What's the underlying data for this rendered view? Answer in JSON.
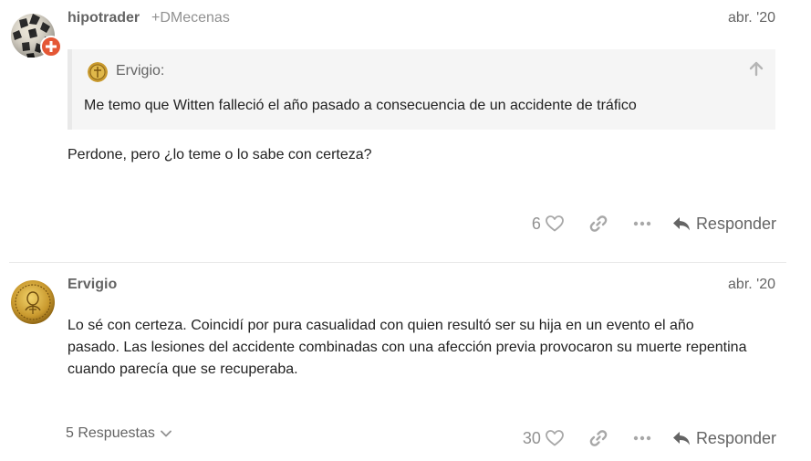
{
  "posts": [
    {
      "username": "hipotrader",
      "group": "+DMecenas",
      "date": "abr. '20",
      "quote": {
        "author": "Ervigio:",
        "text": "Me temo que Witten falleció el año pasado a consecuencia de un accidente de tráfico"
      },
      "body": "Perdone, pero ¿lo teme o lo sabe con certeza?",
      "likes": "6",
      "reply_label": "Responder"
    },
    {
      "username": "Ervigio",
      "date": "abr. '20",
      "body": "Lo sé con certeza. Coincidí por pura casualidad con quien resultó ser su hija en un evento el año pasado. Las lesiones del accidente combinadas con una afección previa provocaron su muerte repentina cuando parecía que se recuperaba.",
      "likes": "30",
      "replies_label": "5 Respuestas",
      "reply_label": "Responder"
    }
  ],
  "icons": {
    "flair": "plus-icon",
    "quote_nav": "arrow-up-icon",
    "like": "heart-icon",
    "share": "link-icon",
    "more": "ellipsis-icon",
    "reply": "reply-icon",
    "expand": "chevron-down-icon"
  },
  "colors": {
    "flair_bg": "#e45735",
    "muted": "#919191",
    "text": "#222222",
    "quote_bg": "#f5f5f5"
  }
}
